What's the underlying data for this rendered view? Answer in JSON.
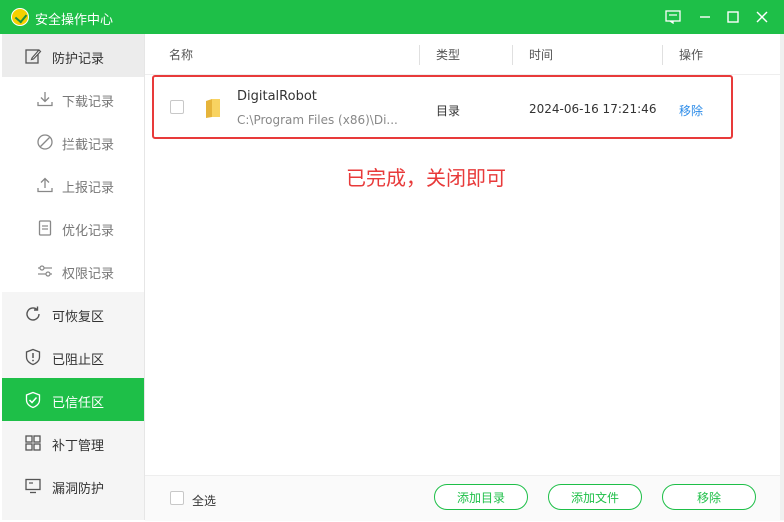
{
  "window": {
    "title": "安全操作中心"
  },
  "sidebar": {
    "items": [
      {
        "label": "防护记录",
        "icon": "edit-icon"
      },
      {
        "label": "下载记录",
        "icon": "download-icon"
      },
      {
        "label": "拦截记录",
        "icon": "block-icon"
      },
      {
        "label": "上报记录",
        "icon": "upload-icon"
      },
      {
        "label": "优化记录",
        "icon": "document-icon"
      },
      {
        "label": "权限记录",
        "icon": "sliders-icon"
      },
      {
        "label": "可恢复区",
        "icon": "restore-icon"
      },
      {
        "label": "已阻止区",
        "icon": "shield-alert-icon"
      },
      {
        "label": "已信任区",
        "icon": "shield-check-icon"
      },
      {
        "label": "补丁管理",
        "icon": "grid-icon"
      },
      {
        "label": "漏洞防护",
        "icon": "monitor-icon"
      }
    ],
    "active": "已信任区"
  },
  "table": {
    "columns": {
      "name": "名称",
      "type": "类型",
      "time": "时间",
      "action": "操作"
    },
    "rows": [
      {
        "name": "DigitalRobot",
        "path": "C:\\Program Files (x86)\\Di...",
        "type": "目录",
        "time": "2024-06-16 17:21:46",
        "action": "移除"
      }
    ]
  },
  "annotation": "已完成，关闭即可",
  "footer": {
    "select_all": "全选",
    "add_folder": "添加目录",
    "add_file": "添加文件",
    "remove": "移除"
  },
  "colors": {
    "brand": "#1ebf48",
    "annotation": "#e83a3a",
    "link": "#2b8be8"
  }
}
